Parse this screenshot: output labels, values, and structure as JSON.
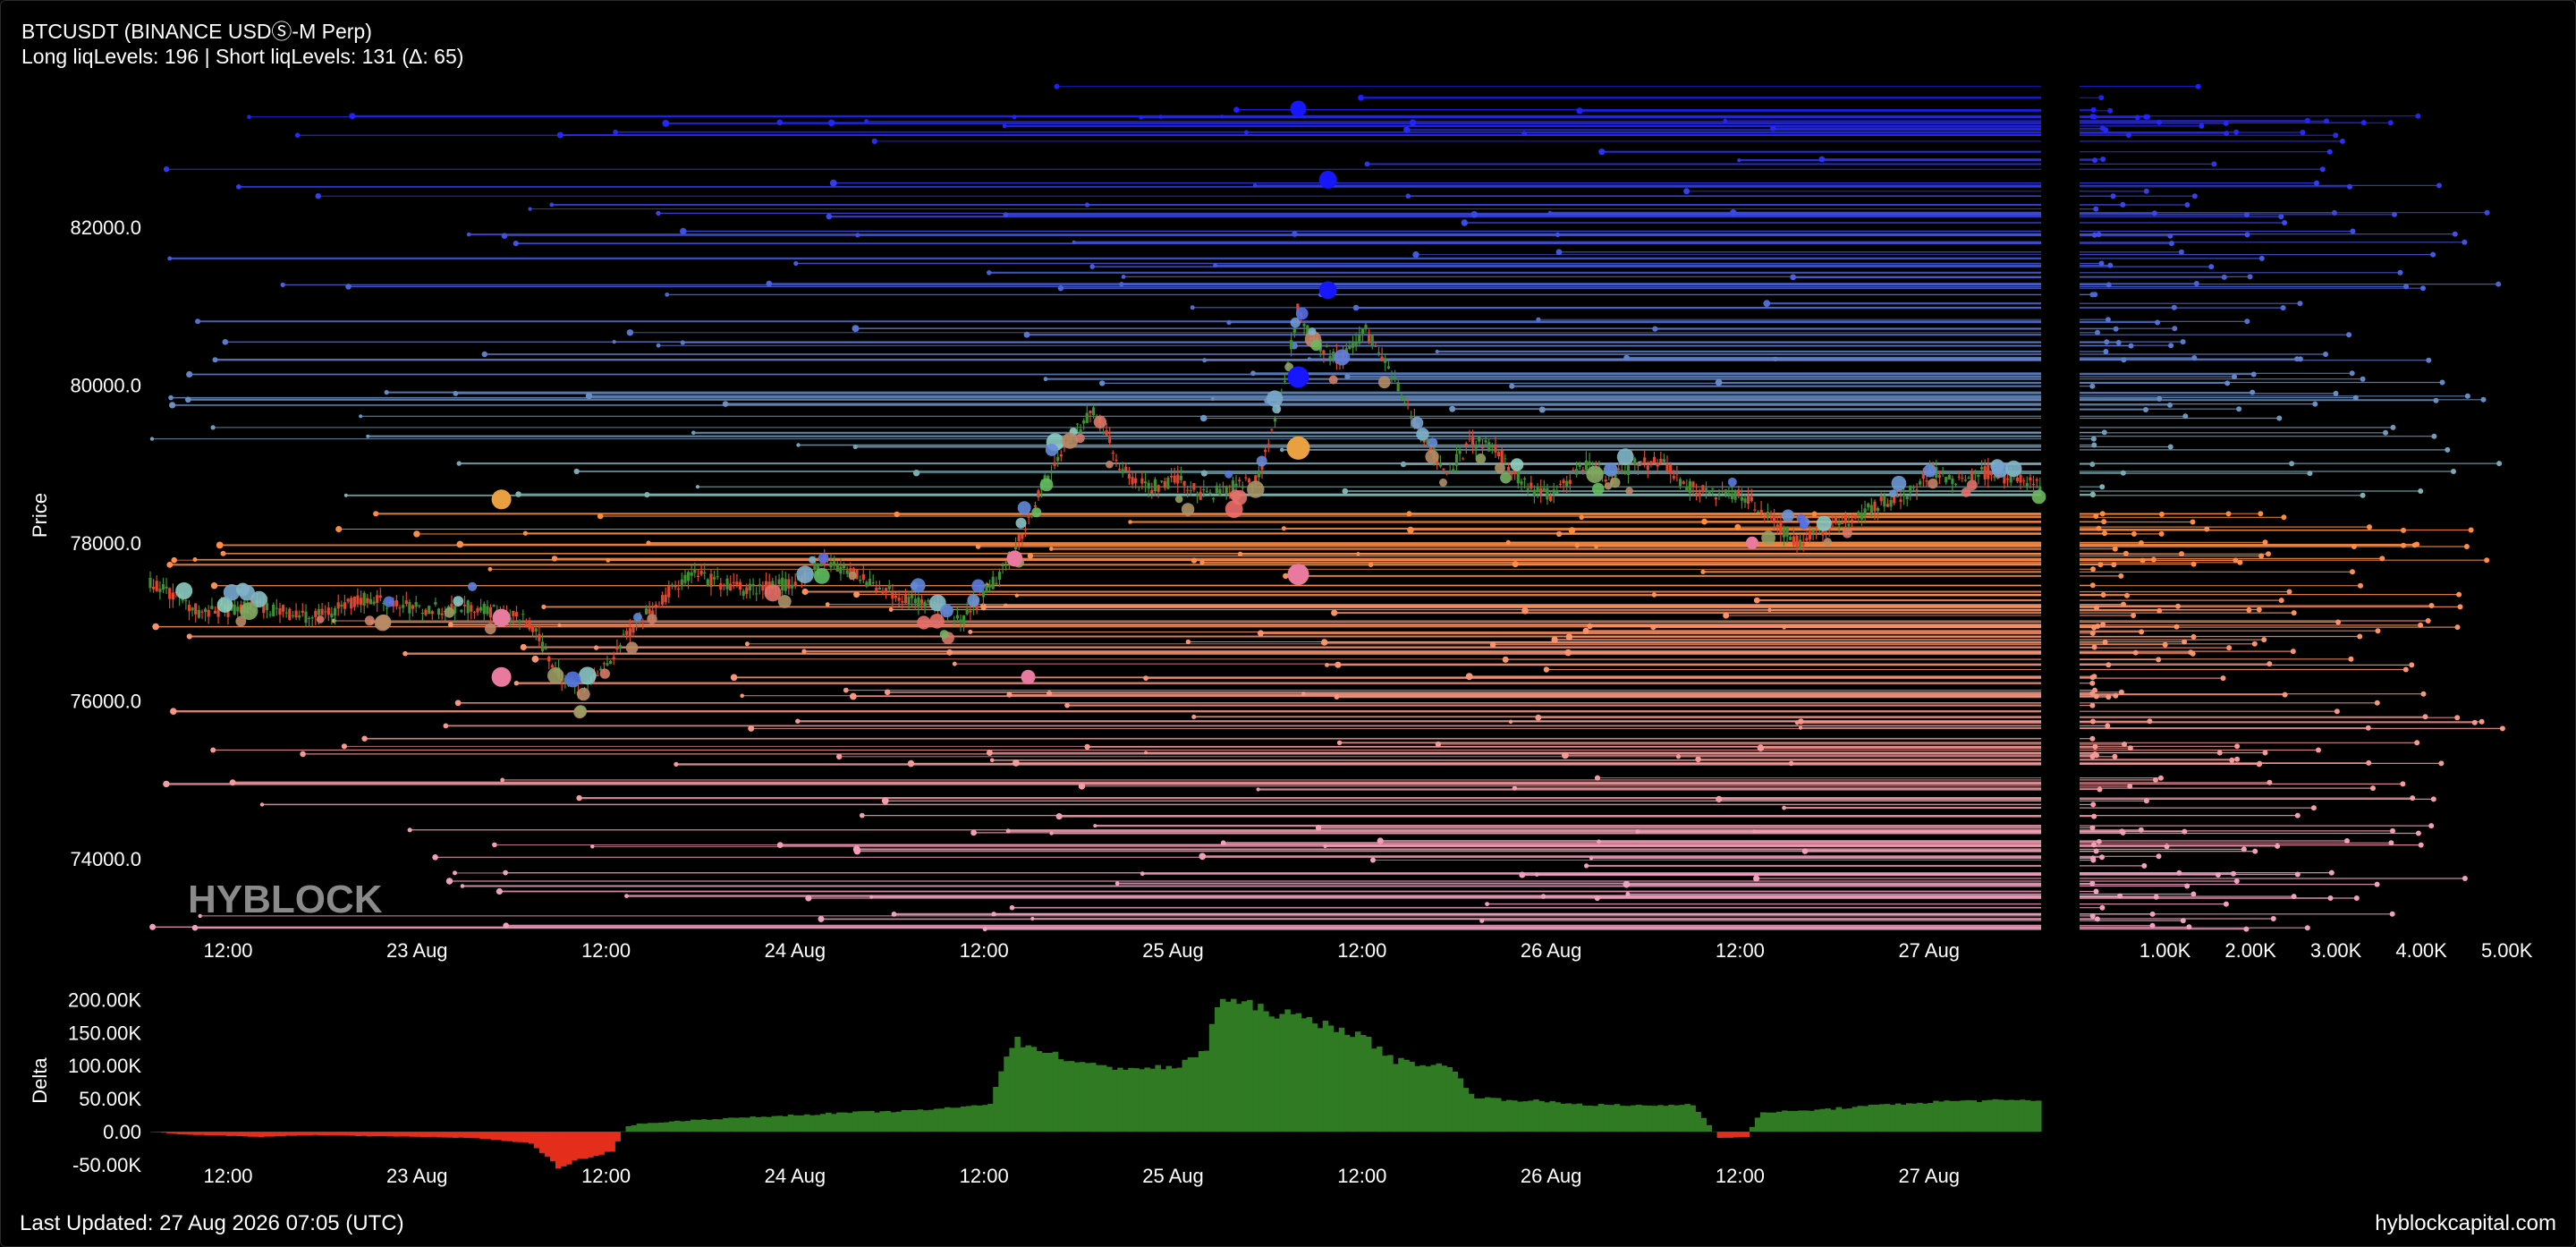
{
  "header": {
    "title": "BTCUSDT (BINANCE USDⓈ-M Perp)",
    "subtitle": "Long liqLevels: 196 | Short liqLevels: 131 (Δ: 65)"
  },
  "watermark": "HYBLOCK",
  "footer": {
    "updated": "Last Updated: 27 Aug 2026 07:05 (UTC)",
    "site": "hyblockcapital.com"
  },
  "colors": {
    "background": "#000000",
    "candle_up": "#3f8f33",
    "candle_down": "#e0452f",
    "long_levels": "#f2a0c0",
    "short_levels": "#1e1eff",
    "delta_positive": "#2f7a22",
    "delta_negative": "#e52d1b"
  },
  "chart_data": [
    {
      "type": "line",
      "name": "price_with_liquidation_levels",
      "ylabel": "Price",
      "xlabel": "",
      "ylim": [
        73000,
        83800
      ],
      "yticks": [
        "74000.0",
        "76000.0",
        "78000.0",
        "80000.0",
        "82000.0"
      ],
      "xticks": [
        "12:00",
        "23 Aug",
        "12:00",
        "24 Aug",
        "12:00",
        "25 Aug",
        "12:00",
        "26 Aug",
        "12:00",
        "27 Aug"
      ],
      "price_path": [
        [
          0,
          77500
        ],
        [
          2,
          77100
        ],
        [
          4,
          77200
        ],
        [
          6,
          77050
        ],
        [
          8,
          77300
        ],
        [
          10,
          77150
        ],
        [
          12,
          77200
        ],
        [
          14,
          77000
        ],
        [
          15,
          76400
        ],
        [
          16,
          76100
        ],
        [
          17,
          76500
        ],
        [
          18,
          77000
        ],
        [
          19,
          77300
        ],
        [
          20,
          77600
        ],
        [
          22,
          77400
        ],
        [
          24,
          77500
        ],
        [
          25,
          77800
        ],
        [
          26,
          77600
        ],
        [
          28,
          77300
        ],
        [
          29,
          77200
        ],
        [
          30,
          77000
        ],
        [
          31,
          77400
        ],
        [
          32,
          77900
        ],
        [
          33,
          78700
        ],
        [
          34,
          79300
        ],
        [
          35,
          79700
        ],
        [
          36,
          78900
        ],
        [
          37,
          78700
        ],
        [
          38,
          78800
        ],
        [
          39,
          78600
        ],
        [
          40,
          78700
        ],
        [
          41,
          78800
        ],
        [
          42,
          80000
        ],
        [
          42.5,
          81000
        ],
        [
          43,
          80600
        ],
        [
          44,
          80300
        ],
        [
          45,
          80700
        ],
        [
          46,
          80100
        ],
        [
          47,
          79400
        ],
        [
          48,
          78900
        ],
        [
          49,
          79300
        ],
        [
          50,
          79100
        ],
        [
          51,
          78700
        ],
        [
          52,
          78600
        ],
        [
          53,
          79000
        ],
        [
          54,
          78800
        ],
        [
          55,
          79000
        ],
        [
          56,
          79000
        ],
        [
          57,
          78700
        ],
        [
          58,
          78600
        ],
        [
          59,
          78600
        ],
        [
          60,
          78300
        ],
        [
          61,
          78000
        ],
        [
          62,
          78200
        ],
        [
          63,
          78300
        ],
        [
          64,
          78500
        ],
        [
          65,
          78600
        ],
        [
          66,
          78900
        ],
        [
          67,
          78800
        ],
        [
          68,
          78900
        ],
        [
          69,
          78800
        ],
        [
          70,
          78700
        ]
      ],
      "long_levels_count": 196,
      "short_levels_count": 131
    },
    {
      "type": "bar",
      "name": "liquidation_size_profile",
      "xticks": [
        "1.00K",
        "2.00K",
        "3.00K",
        "4.00K",
        "5.00K"
      ],
      "xlim": [
        0,
        5600
      ]
    },
    {
      "type": "area",
      "name": "delta",
      "ylabel": "Delta",
      "ylim": [
        -50000,
        210000
      ],
      "yticks": [
        "-50.00K",
        "0.00",
        "50.00K",
        "100.00K",
        "150.00K",
        "200.00K"
      ],
      "xticks": [
        "12:00",
        "23 Aug",
        "12:00",
        "24 Aug",
        "12:00",
        "25 Aug",
        "12:00",
        "26 Aug",
        "12:00",
        "27 Aug"
      ],
      "values": [
        [
          0,
          0
        ],
        [
          1,
          -4000
        ],
        [
          4,
          -8000
        ],
        [
          6,
          -5000
        ],
        [
          8,
          -7000
        ],
        [
          10,
          -8000
        ],
        [
          12,
          -10000
        ],
        [
          14,
          -18000
        ],
        [
          15,
          -55000
        ],
        [
          16,
          -40000
        ],
        [
          17,
          -30000
        ],
        [
          17.5,
          8000
        ],
        [
          18,
          12000
        ],
        [
          20,
          18000
        ],
        [
          22,
          22000
        ],
        [
          24,
          26000
        ],
        [
          26,
          30000
        ],
        [
          28,
          32000
        ],
        [
          30,
          38000
        ],
        [
          31,
          44000
        ],
        [
          31.5,
          110000
        ],
        [
          32,
          140000
        ],
        [
          33,
          125000
        ],
        [
          34,
          110000
        ],
        [
          35,
          100000
        ],
        [
          37,
          98000
        ],
        [
          38,
          100000
        ],
        [
          39,
          130000
        ],
        [
          39.5,
          210000
        ],
        [
          40,
          200000
        ],
        [
          42,
          180000
        ],
        [
          44,
          160000
        ],
        [
          45,
          140000
        ],
        [
          46,
          110000
        ],
        [
          47,
          105000
        ],
        [
          48,
          100000
        ],
        [
          49,
          52000
        ],
        [
          51,
          48000
        ],
        [
          53,
          42000
        ],
        [
          55,
          40000
        ],
        [
          57,
          42000
        ],
        [
          58,
          -10000
        ],
        [
          59,
          -8000
        ],
        [
          59.5,
          30000
        ],
        [
          61,
          32000
        ],
        [
          63,
          38000
        ],
        [
          65,
          44000
        ],
        [
          67,
          48000
        ],
        [
          70,
          48000
        ]
      ]
    }
  ]
}
